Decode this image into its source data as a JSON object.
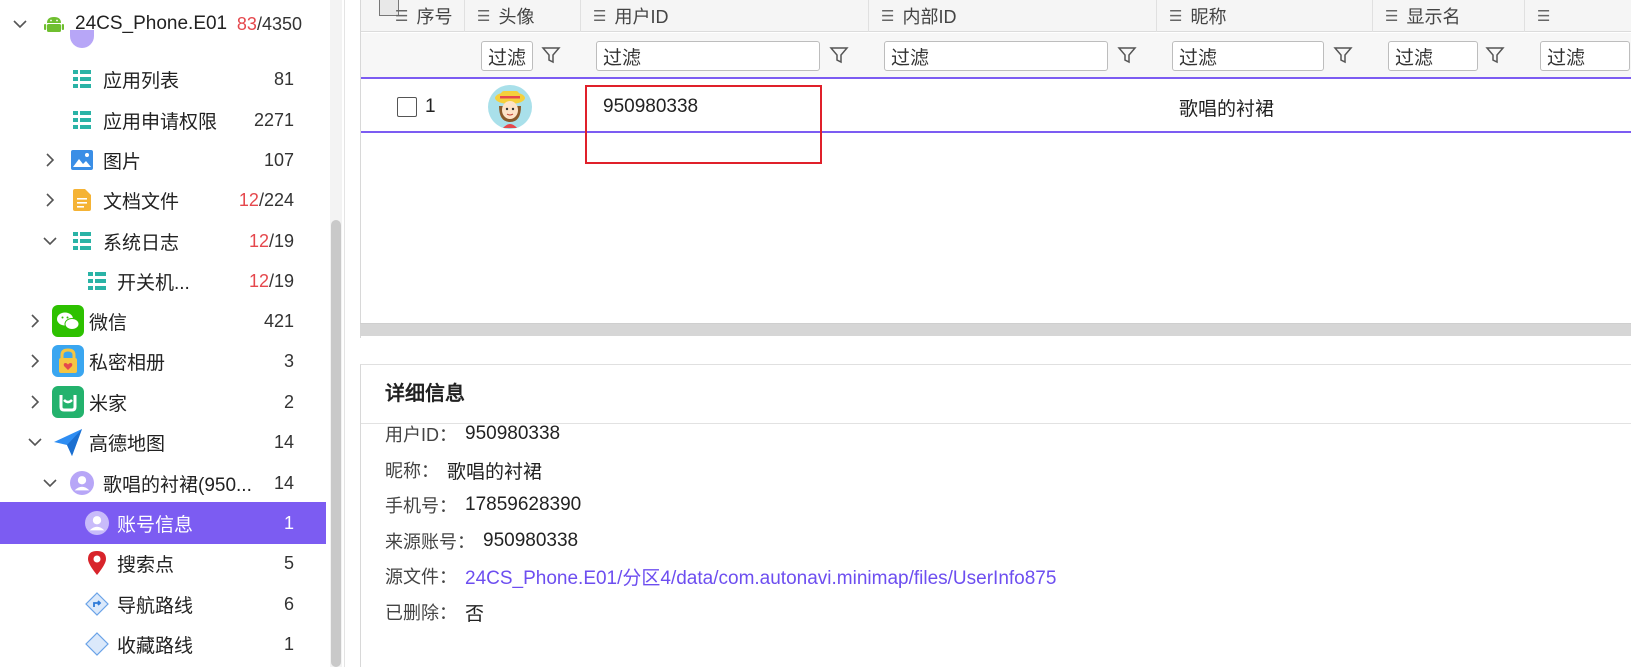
{
  "tree": {
    "items": [
      {
        "label": "24CS_Phone.E01",
        "count_red": "83",
        "count_rest": "/4350"
      },
      {
        "label": "应用列表",
        "count_red": "",
        "count_rest": "81"
      },
      {
        "label": "应用申请权限",
        "count_red": "",
        "count_rest": "2271"
      },
      {
        "label": "图片",
        "count_red": "",
        "count_rest": "107"
      },
      {
        "label": "文档文件",
        "count_red": "12",
        "count_rest": "/224"
      },
      {
        "label": "系统日志",
        "count_red": "12",
        "count_rest": "/19"
      },
      {
        "label": "开关机...",
        "count_red": "12",
        "count_rest": "/19"
      },
      {
        "label": "微信",
        "count_red": "",
        "count_rest": "421"
      },
      {
        "label": "私密相册",
        "count_red": "",
        "count_rest": "3"
      },
      {
        "label": "米家",
        "count_red": "",
        "count_rest": "2"
      },
      {
        "label": "高德地图",
        "count_red": "",
        "count_rest": "14"
      },
      {
        "label": "歌唱的衬裙(950...",
        "count_red": "",
        "count_rest": "14"
      },
      {
        "label": "账号信息",
        "count_red": "",
        "count_rest": "1"
      },
      {
        "label": "搜索点",
        "count_red": "",
        "count_rest": "5"
      },
      {
        "label": "导航路线",
        "count_red": "",
        "count_rest": "6"
      },
      {
        "label": "收藏路线",
        "count_red": "",
        "count_rest": "1"
      }
    ],
    "selected_index": 12
  },
  "grid": {
    "columns": [
      "序号",
      "头像",
      "用户ID",
      "内部ID",
      "昵称",
      "显示名",
      ""
    ],
    "filter_placeholder": "过滤",
    "rows": [
      {
        "index": "1",
        "user_id": "950980338",
        "internal_id": "",
        "nickname": "歌唱的衬裙",
        "display_name": ""
      }
    ]
  },
  "detail": {
    "title": "详细信息",
    "fields": [
      {
        "key": "用户ID：",
        "value": "950980338"
      },
      {
        "key": "昵称：",
        "value": "歌唱的衬裙"
      },
      {
        "key": "手机号：",
        "value": "17859628390"
      },
      {
        "key": "来源账号：",
        "value": "950980338"
      },
      {
        "key": "源文件：",
        "value": "24CS_Phone.E01/分区4/data/com.autonavi.minimap/files/UserInfo875"
      },
      {
        "key": "已删除：",
        "value": "否"
      }
    ]
  },
  "colors": {
    "accent": "#7c5cf2",
    "highlight_red": "#e0202a",
    "link": "#6d4ef0",
    "count_red": "#e5484d"
  }
}
